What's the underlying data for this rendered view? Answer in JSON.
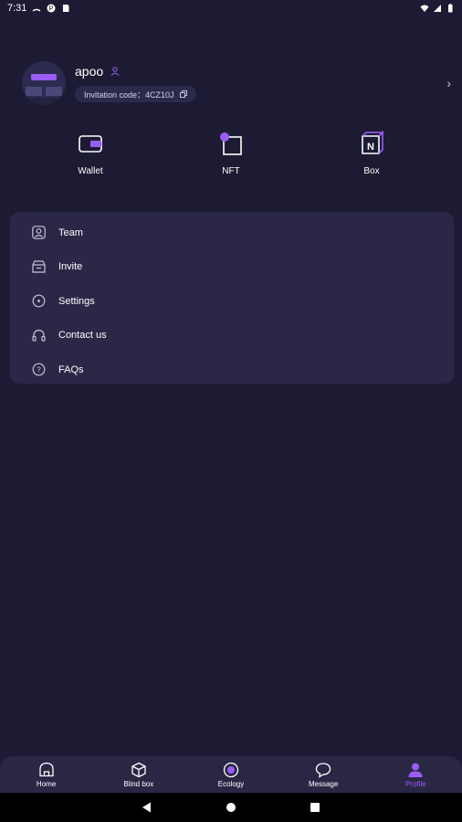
{
  "status_bar": {
    "time": "7:31"
  },
  "profile": {
    "username": "apoo",
    "invitation_code_label": "Invitation code：4CZ10J"
  },
  "quick_actions": [
    {
      "label": "Wallet",
      "icon": "wallet-icon"
    },
    {
      "label": "NFT",
      "icon": "nft-icon"
    },
    {
      "label": "Box",
      "icon": "box-icon"
    }
  ],
  "menu": [
    {
      "label": "Team",
      "icon": "team-icon"
    },
    {
      "label": "Invite",
      "icon": "invite-icon"
    },
    {
      "label": "Settings",
      "icon": "settings-icon"
    },
    {
      "label": "Contact us",
      "icon": "headset-icon"
    },
    {
      "label": "FAQs",
      "icon": "question-icon"
    }
  ],
  "bottom_nav": [
    {
      "label": "Home",
      "icon": "home-icon",
      "active": false
    },
    {
      "label": "Blind box",
      "icon": "cube-icon",
      "active": false
    },
    {
      "label": "Ecology",
      "icon": "ecology-icon",
      "active": false
    },
    {
      "label": "Message",
      "icon": "chat-icon",
      "active": false
    },
    {
      "label": "Profile",
      "icon": "user-icon",
      "active": true
    }
  ],
  "colors": {
    "background": "#1c1b33",
    "card": "#2b2847",
    "accent": "#9b5cf6",
    "text": "#ffffff"
  }
}
